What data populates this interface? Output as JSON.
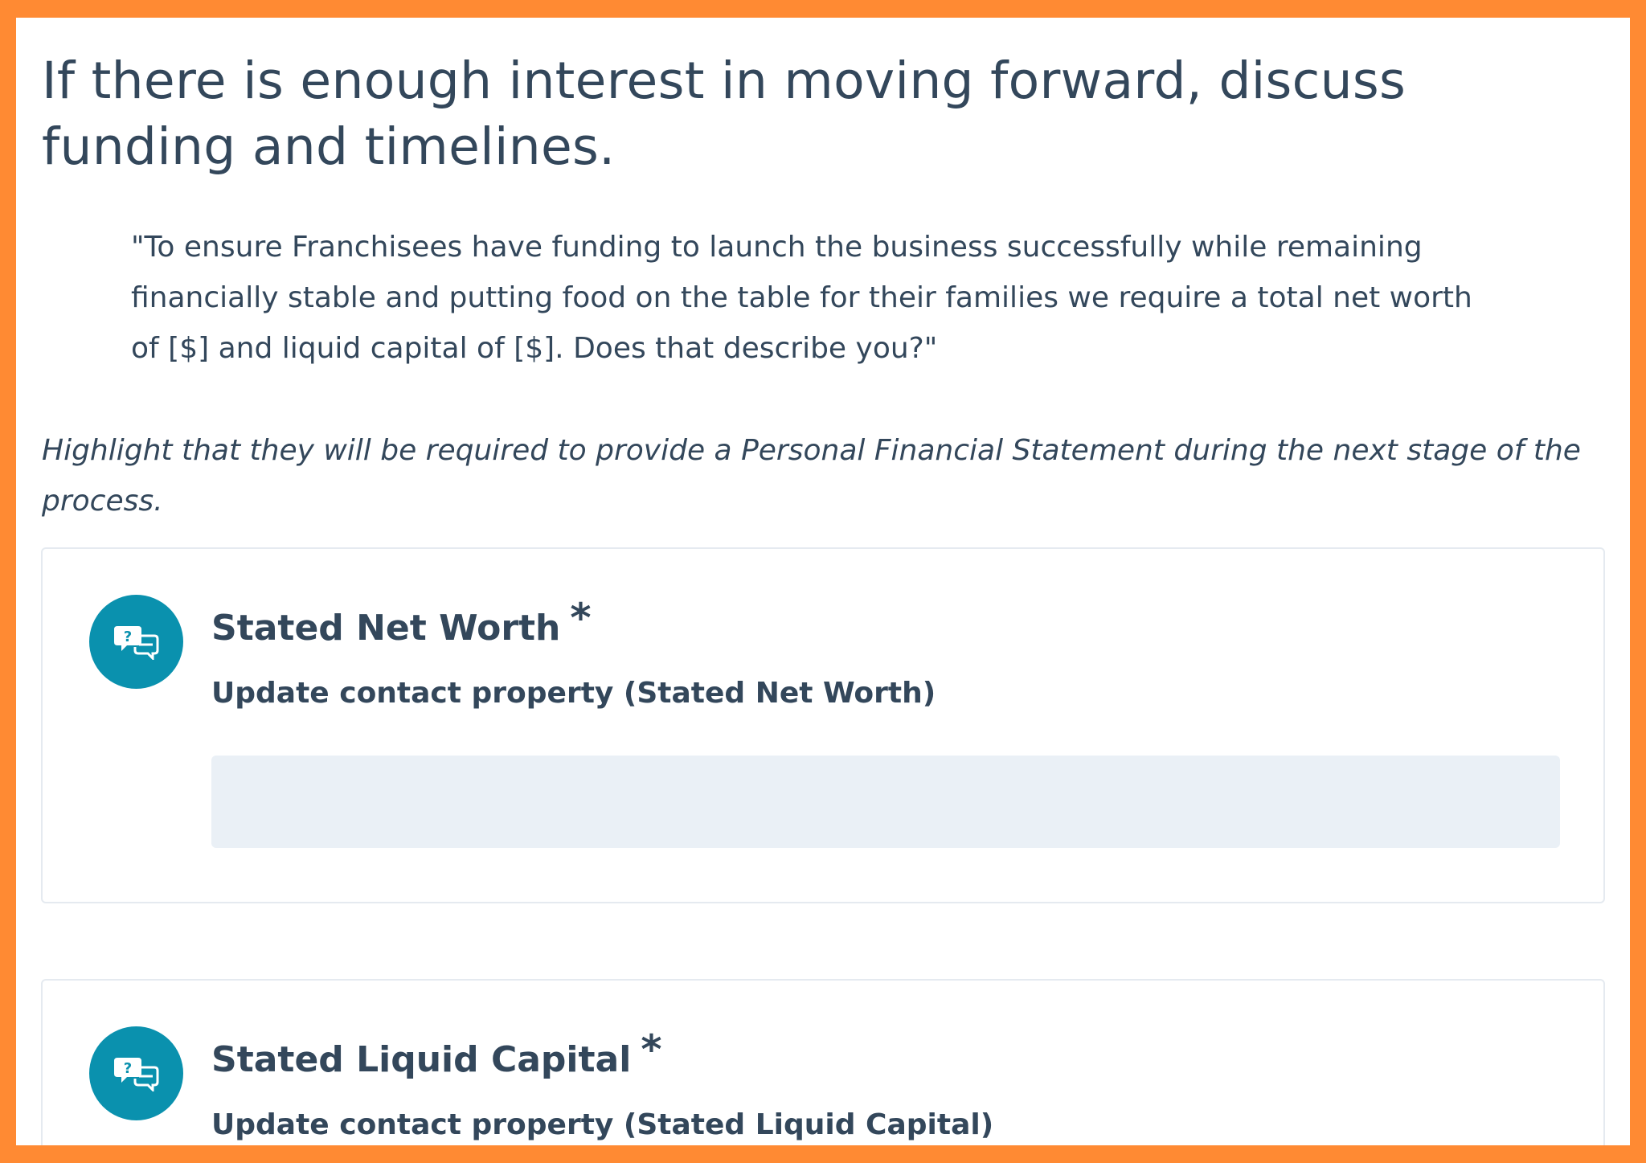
{
  "page": {
    "heading": "If there is enough interest in moving forward, discuss funding and timelines.",
    "quote": "\"To ensure Franchisees have funding to launch the business successfully while remaining financially stable and putting food on the table for their families we require a total net worth of [$] and liquid capital of [$]. Does that describe you?\"",
    "note": "Highlight that they will be required to provide a Personal Financial Statement during the next stage of the process."
  },
  "questions": [
    {
      "title": "Stated Net Worth",
      "required_mark": "*",
      "subtitle": "Update contact property (Stated Net Worth)",
      "value": "",
      "icon": "question-chat-icon"
    },
    {
      "title": "Stated Liquid Capital",
      "required_mark": "*",
      "subtitle": "Update contact property (Stated Liquid Capital)",
      "icon": "question-chat-icon"
    }
  ],
  "colors": {
    "frame": "#ff8a33",
    "text": "#33475b",
    "icon_bg": "#0a91ae",
    "input_bg": "#eaf0f6",
    "card_border": "#e5eaf0"
  }
}
